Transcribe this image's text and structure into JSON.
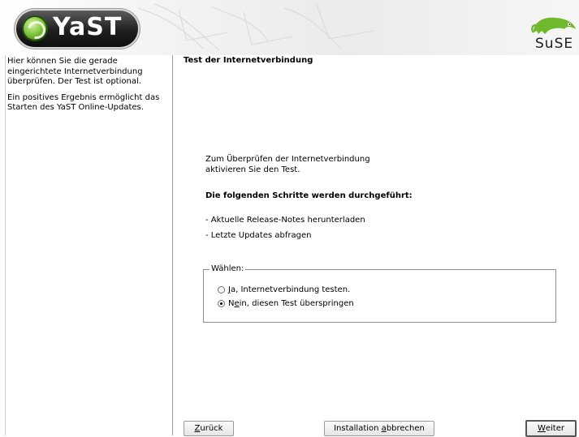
{
  "header": {
    "yast_logo_text": "YaST",
    "suse_logo_text": "SuSE",
    "colors": {
      "logo_bg": "#1f1f1f",
      "logo_ball": "#7dc23b",
      "chameleon": "#6fba2c"
    }
  },
  "help": {
    "paragraphs": [
      "Hier können Sie die gerade eingerichtete Internetverbindung überprüfen. Der Test ist optional.",
      "Ein positives Ergebnis ermöglicht das Starten des YaST Online-Updates."
    ]
  },
  "main": {
    "title": "Test der Internetverbindung",
    "intro_line1": "Zum Überprüfen der Internetverbindung",
    "intro_line2": "aktivieren Sie den Test.",
    "steps_heading": "Die folgenden Schritte werden durchgeführt:",
    "steps": [
      "- Aktuelle Release-Notes herunterladen",
      "- Letzte Updates abfragen"
    ],
    "group": {
      "legend": "Wählen:",
      "options": [
        {
          "shortcut": "J",
          "rest": "a, Internetverbindung testen.",
          "selected": false
        },
        {
          "prefix": "N",
          "shortcut": "e",
          "rest": "in, diesen Test überspringen",
          "selected": true
        }
      ]
    }
  },
  "buttons": {
    "back": {
      "shortcut": "Z",
      "rest": "urück"
    },
    "abort": {
      "prefix": "Installation ",
      "shortcut": "a",
      "rest": "bbrechen"
    },
    "next": {
      "shortcut": "W",
      "rest": "eiter"
    }
  }
}
